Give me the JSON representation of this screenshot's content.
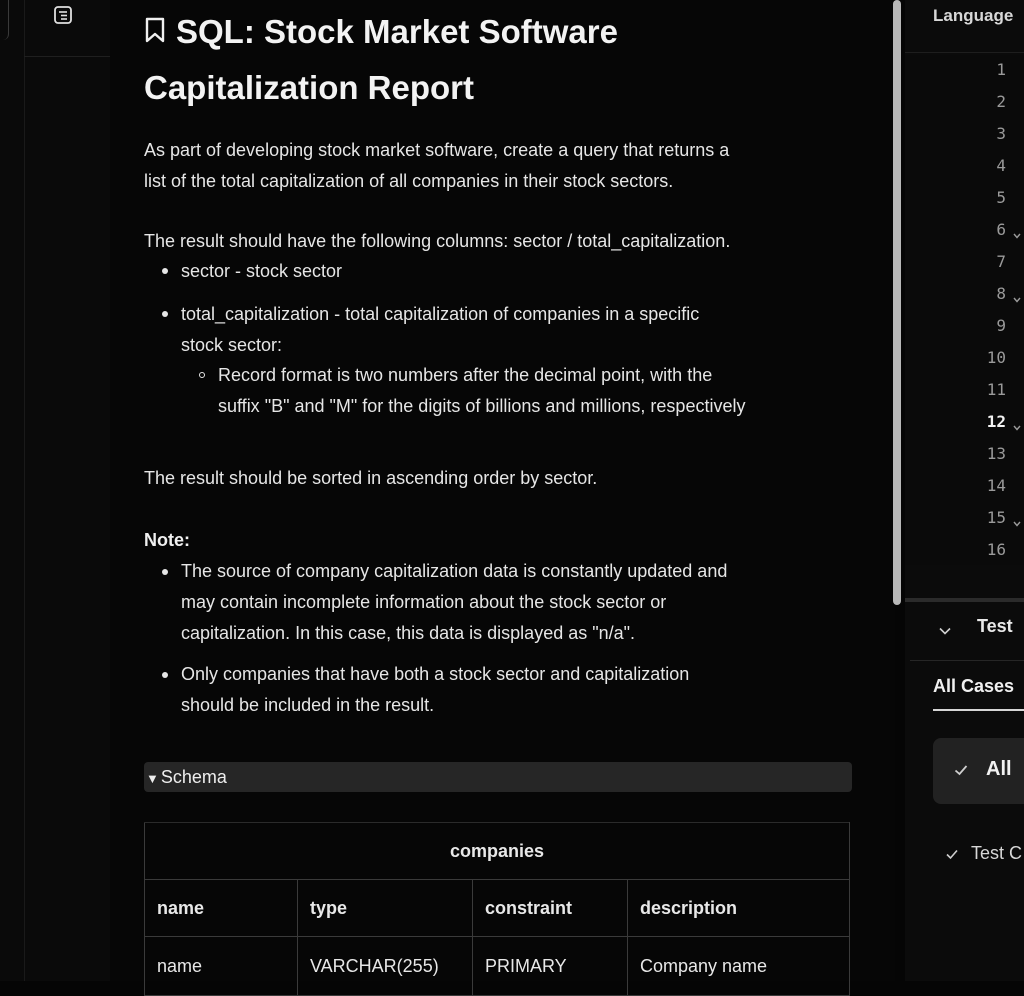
{
  "problem": {
    "title": "SQL: Stock Market Software Capitalization Report",
    "title_line1": "SQL: Stock Market Software",
    "title_line2": "Capitalization Report",
    "intro_line1": "As part of developing stock market software, create a query that returns a",
    "intro_line2": "list of the total capitalization of all companies in their stock sectors.",
    "columns_intro": "The result should have the following columns: sector / total_capitalization.",
    "bullets": {
      "sector": "sector - stock sector",
      "total_cap_line1": "total_capitalization - total capitalization of companies in a specific",
      "total_cap_line2": "stock sector:",
      "format_line1": "Record format is two numbers after the decimal point, with the",
      "format_line2": "suffix \"B\" and \"M\" for the digits of billions and millions, respectively"
    },
    "sorting": "The result should be sorted in ascending order by sector.",
    "note_label": "Note:",
    "notes": {
      "n1_line1": "The source of company capitalization data is constantly updated and",
      "n1_line2": "may contain incomplete information about the stock sector or",
      "n1_line3": "capitalization. In this case, this data is displayed as \"n/a\".",
      "n2_line1": "Only companies that have both a stock sector and capitalization",
      "n2_line2": "should be included in the result."
    }
  },
  "schema": {
    "toggle_label": "Schema",
    "table_name": "companies",
    "columns": [
      "name",
      "type",
      "constraint",
      "description"
    ],
    "rows": [
      [
        "name",
        "VARCHAR(255)",
        "PRIMARY",
        "Company name"
      ]
    ]
  },
  "editor": {
    "language_label": "Language",
    "line_numbers": [
      "1",
      "2",
      "3",
      "4",
      "5",
      "6",
      "7",
      "8",
      "9",
      "10",
      "11",
      "12",
      "13",
      "14",
      "15",
      "16"
    ],
    "active_line": "12"
  },
  "tests": {
    "header": "Test",
    "tab_all_cases": "All Cases",
    "all_card": "All",
    "item": "Test C"
  }
}
